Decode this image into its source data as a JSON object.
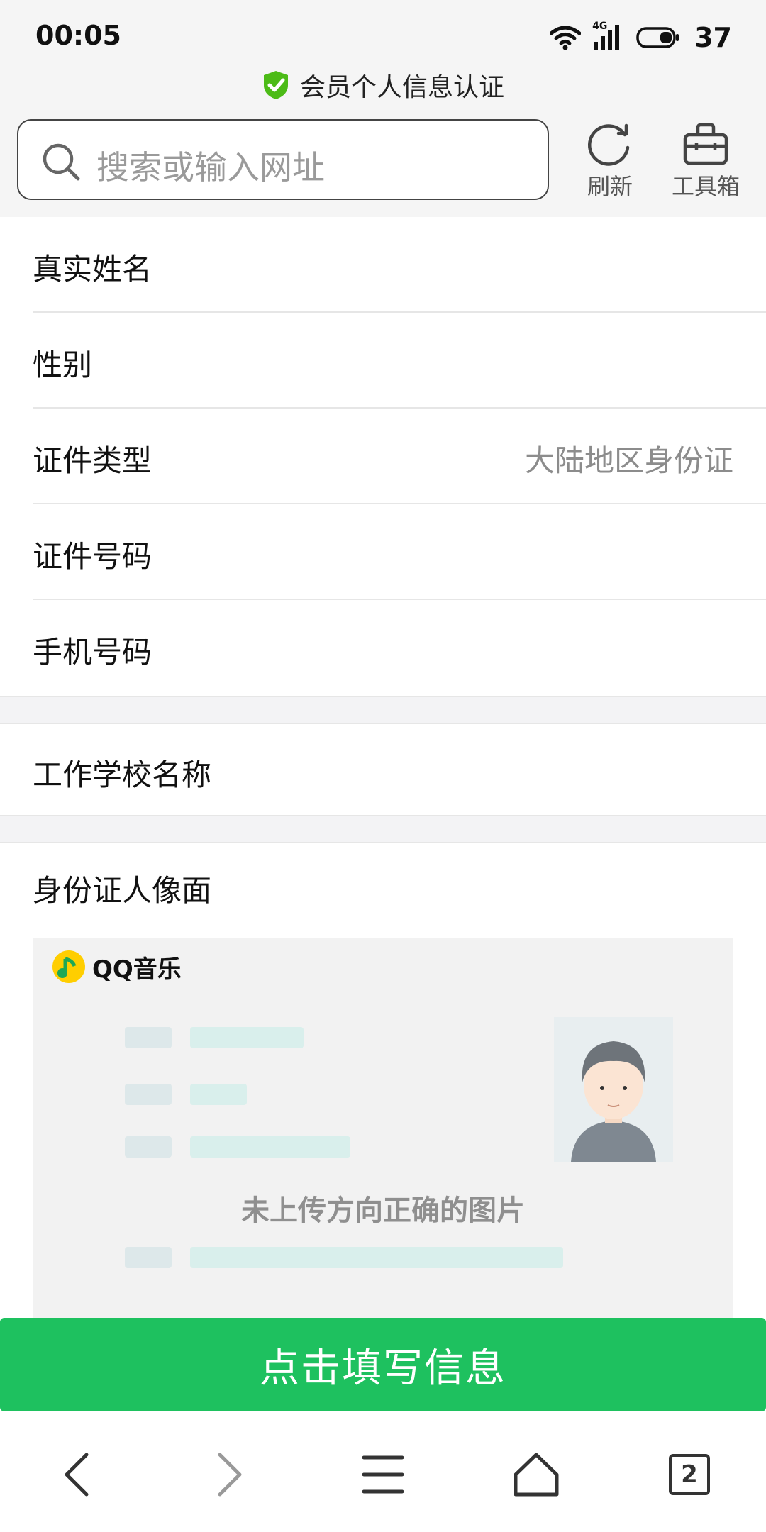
{
  "status_bar": {
    "time": "00:05",
    "network": "4G",
    "battery": "37"
  },
  "browser": {
    "page_title": "会员个人信息认证",
    "search_placeholder": "搜索或输入网址",
    "refresh_label": "刷新",
    "toolbox_label": "工具箱"
  },
  "form": {
    "fields": [
      {
        "label": "真实姓名",
        "value": ""
      },
      {
        "label": "性别",
        "value": ""
      },
      {
        "label": "证件类型",
        "value": "大陆地区身份证"
      },
      {
        "label": "证件号码",
        "value": ""
      },
      {
        "label": "手机号码",
        "value": ""
      }
    ],
    "school_label": "工作学校名称",
    "id_front_label": "身份证人像面"
  },
  "upload_card": {
    "brand": "QQ音乐",
    "hint": "未上传方向正确的图片"
  },
  "action_button": "点击填写信息",
  "bottom_nav": {
    "tab_count": "2"
  },
  "colors": {
    "accent_green": "#1ec15f",
    "shield_green": "#4cbb17"
  }
}
